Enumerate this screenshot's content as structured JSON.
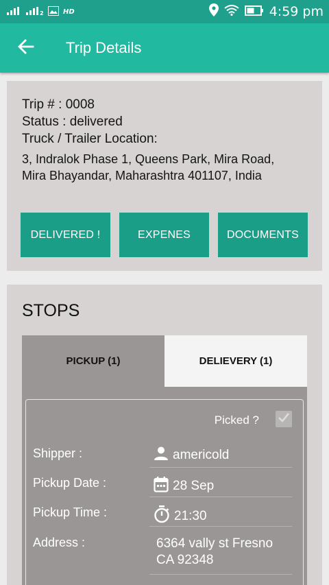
{
  "status_bar": {
    "signal1": "ııl",
    "signal2": "ııl₂",
    "hd": "HD",
    "time": "4:59 pm"
  },
  "appbar": {
    "title": "Trip Details",
    "back_icon": "arrow-left-icon"
  },
  "trip": {
    "number_line": "Trip # : 0008",
    "status_line": "Status :  delivered",
    "location_label": "Truck / Trailer Location:",
    "address_line1": "3, Indralok Phase 1, Queens Park, Mira Road,",
    "address_line2": "Mira Bhayandar, Maharashtra 401107, India",
    "buttons": {
      "delivered": "DELIVERED !",
      "expenses": "EXPENES",
      "documents": "DOCUMENTS"
    }
  },
  "stops": {
    "title": "STOPS",
    "tabs": {
      "pickup": "PICKUP (1)",
      "delivery": "DELIEVERY (1)"
    },
    "detail": {
      "picked_label": "Picked ?",
      "picked_checked": true,
      "shipper_label": "Shipper :",
      "shipper_value": "americold",
      "pickup_date_label": "Pickup Date :",
      "pickup_date_value": "28 Sep",
      "pickup_time_label": "Pickup Time :",
      "pickup_time_value": "21:30",
      "address_label": "Address :",
      "address_line1": "6364 vally st Fresno",
      "address_line2": "CA 92348"
    }
  },
  "colors": {
    "status_bar": "#1fa08c",
    "app_bar": "#22b9a1",
    "button": "#1b9e87",
    "card": "#d6d3d2",
    "tab_active": "#9a9695"
  }
}
